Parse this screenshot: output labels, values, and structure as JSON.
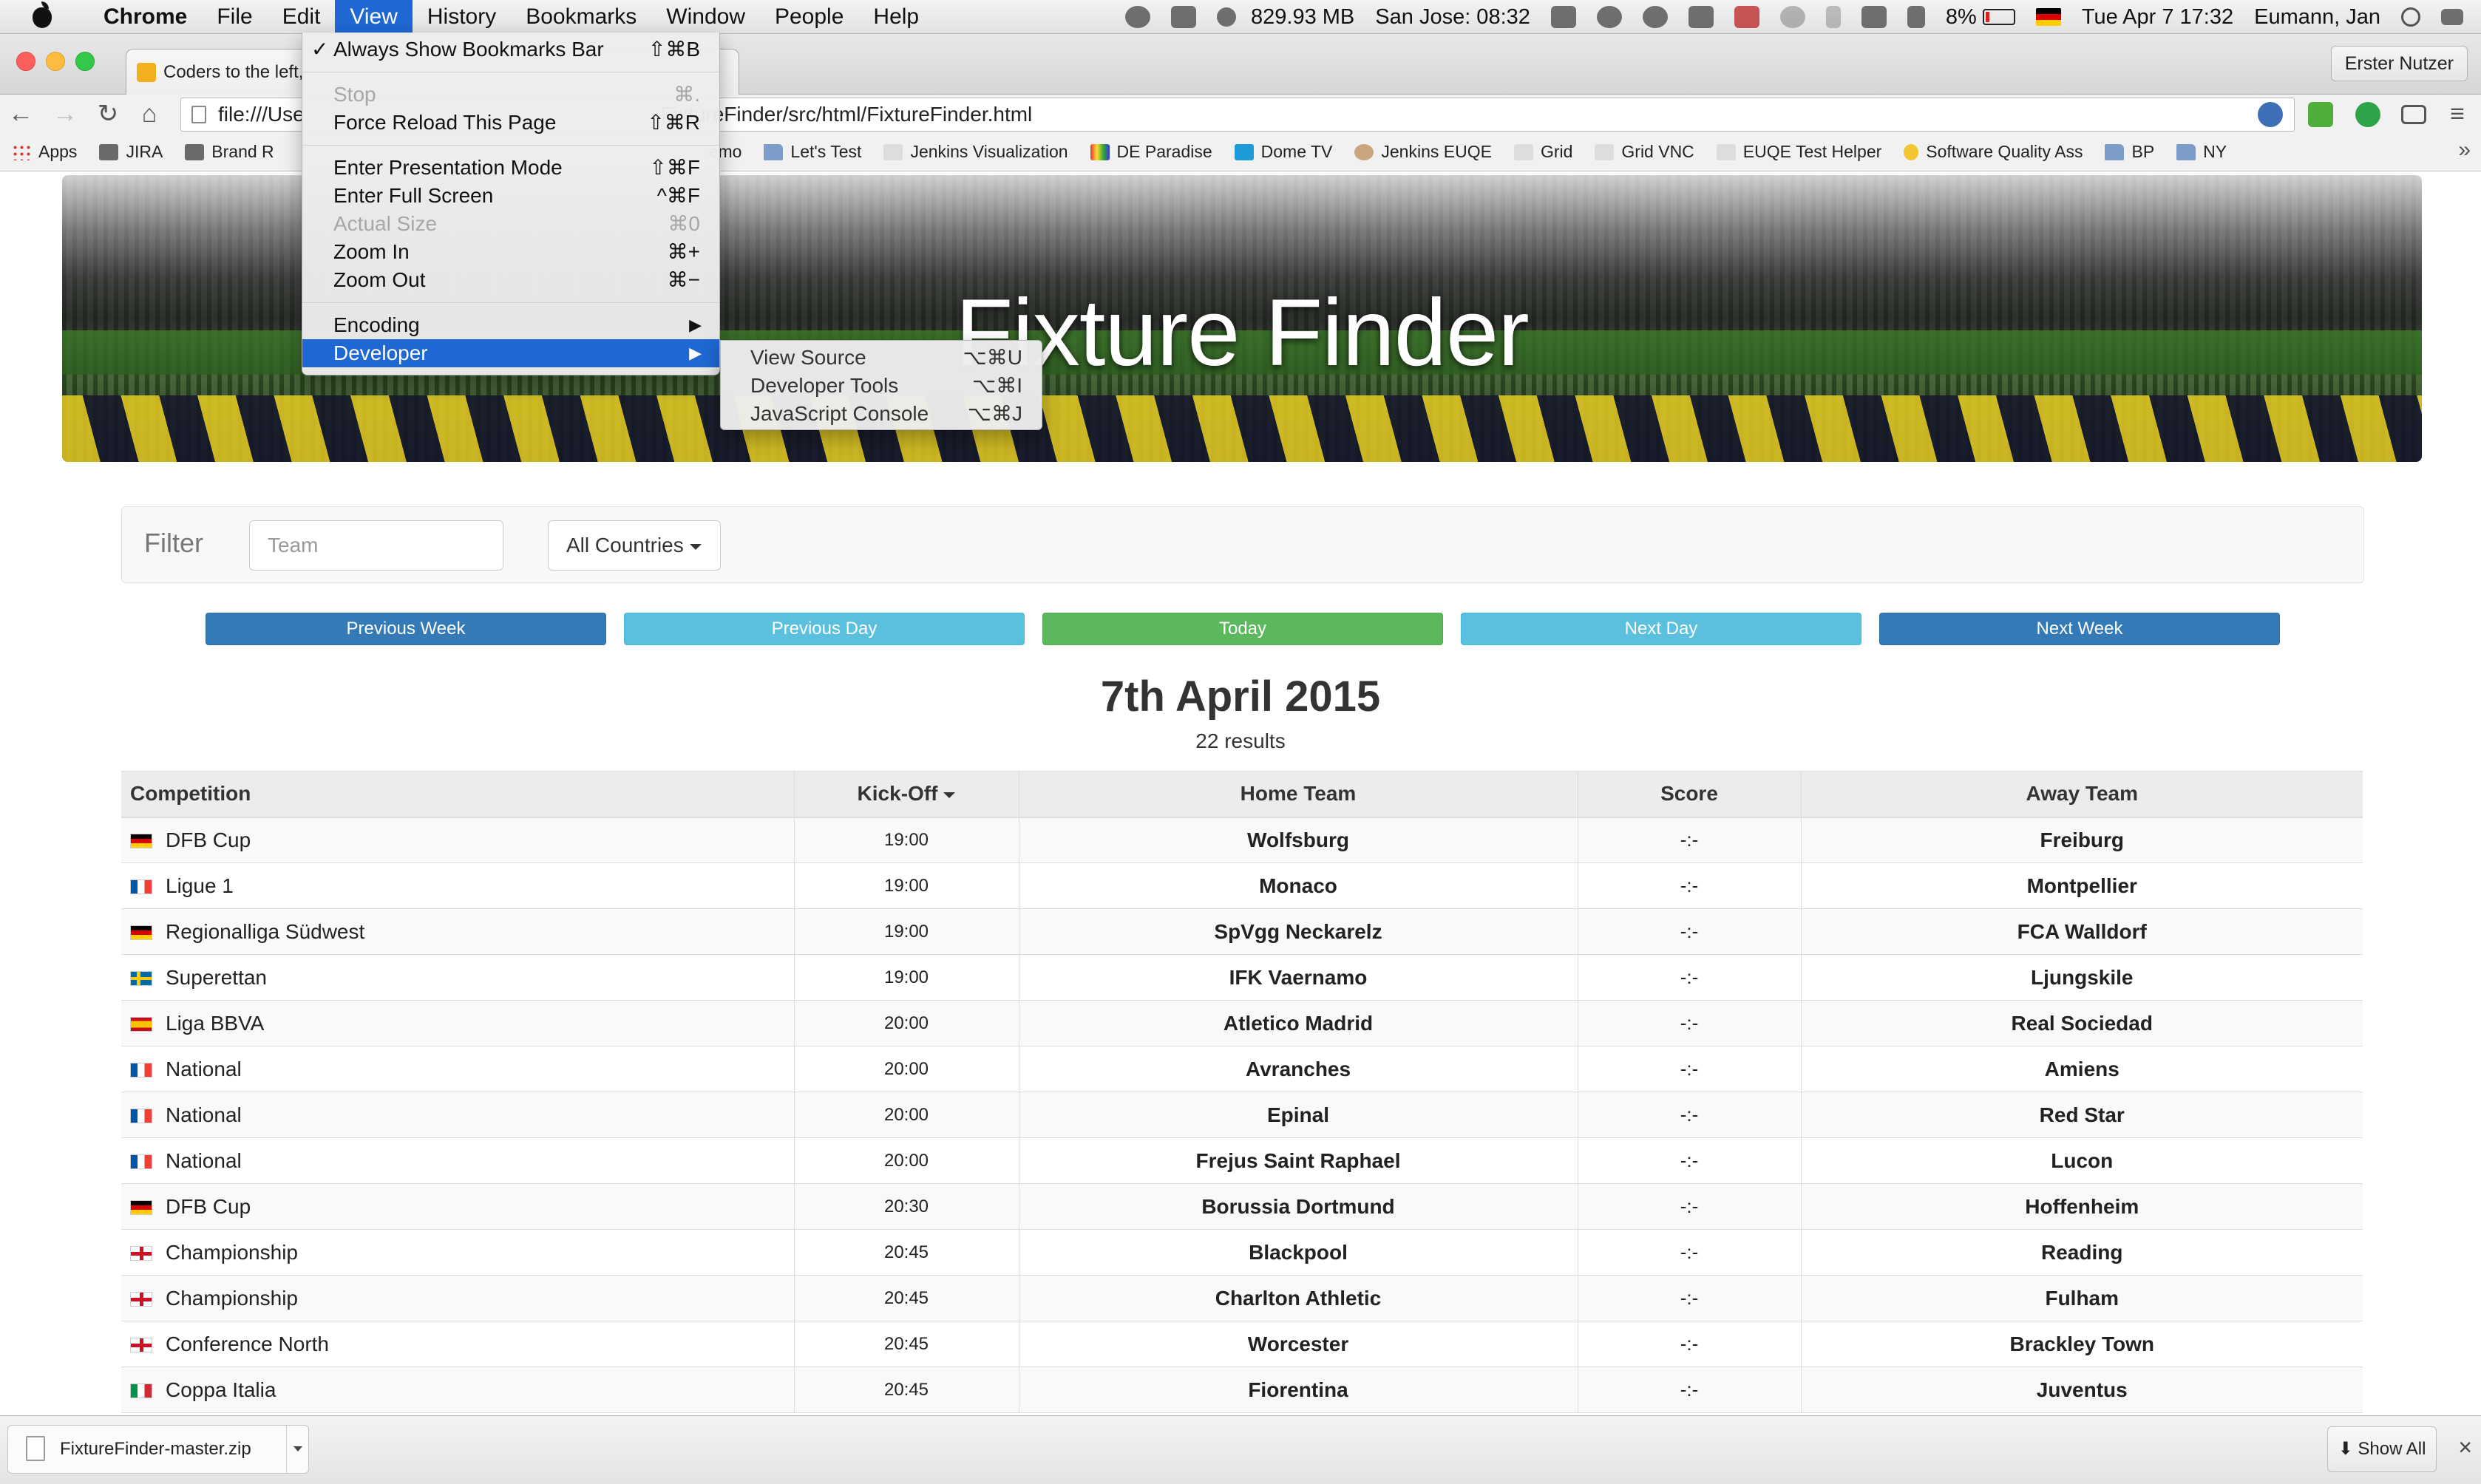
{
  "menubar": {
    "app": "Chrome",
    "items": [
      "File",
      "Edit",
      "View",
      "History",
      "Bookmarks",
      "Window",
      "People",
      "Help"
    ],
    "active_item": "View",
    "status": {
      "memory": "829.93 MB",
      "clock_city": "San Jose: 08:32",
      "battery": "8%",
      "datetime": "Tue Apr 7  17:32",
      "user": "Eumann, Jan"
    }
  },
  "window": {
    "tab_title": "Coders to the left,",
    "profile": "Erster Nutzer"
  },
  "address_bar": {
    "url_left": "file:///Use",
    "url_right": "FixtureFinder/src/html/FixtureFinder.html"
  },
  "bookmarks": {
    "left": [
      "Apps",
      "JIRA",
      "Brand R"
    ],
    "right": [
      {
        "label": "emo",
        "icon": "none"
      },
      {
        "label": "Let's Test",
        "icon": "folder"
      },
      {
        "label": "Jenkins Visualization",
        "icon": "page"
      },
      {
        "label": "DE Paradise",
        "icon": "page"
      },
      {
        "label": "Dome TV",
        "icon": "page"
      },
      {
        "label": "Jenkins EUQE",
        "icon": "page"
      },
      {
        "label": "Grid",
        "icon": "page"
      },
      {
        "label": "Grid VNC",
        "icon": "page"
      },
      {
        "label": "EUQE Test Helper",
        "icon": "page"
      },
      {
        "label": "Software Quality Ass",
        "icon": "page"
      },
      {
        "label": "BP",
        "icon": "folder"
      },
      {
        "label": "NY",
        "icon": "folder"
      }
    ],
    "overflow": "»"
  },
  "view_menu": {
    "always_show_bookmarks": {
      "label": "Always Show Bookmarks Bar",
      "shortcut": "⇧⌘B",
      "check": "✓"
    },
    "stop": {
      "label": "Stop",
      "shortcut": "⌘."
    },
    "force_reload": {
      "label": "Force Reload This Page",
      "shortcut": "⇧⌘R"
    },
    "presentation": {
      "label": "Enter Presentation Mode",
      "shortcut": "⇧⌘F"
    },
    "fullscreen": {
      "label": "Enter Full Screen",
      "shortcut": "^⌘F"
    },
    "actual_size": {
      "label": "Actual Size",
      "shortcut": "⌘0"
    },
    "zoom_in": {
      "label": "Zoom In",
      "shortcut": "⌘+"
    },
    "zoom_out": {
      "label": "Zoom Out",
      "shortcut": "⌘−"
    },
    "encoding": {
      "label": "Encoding"
    },
    "developer": {
      "label": "Developer"
    }
  },
  "developer_submenu": {
    "view_source": {
      "label": "View Source",
      "shortcut": "⌥⌘U"
    },
    "dev_tools": {
      "label": "Developer Tools",
      "shortcut": "⌥⌘I"
    },
    "js_console": {
      "label": "JavaScript Console",
      "shortcut": "⌥⌘J"
    }
  },
  "page": {
    "title": "Fixture Finder",
    "filter": {
      "label": "Filter",
      "team_placeholder": "Team",
      "country_selected": "All Countries"
    },
    "nav": {
      "prev_week": "Previous Week",
      "prev_day": "Previous Day",
      "today": "Today",
      "next_day": "Next Day",
      "next_week": "Next Week"
    },
    "date": "7th April 2015",
    "results": "22 results",
    "colors": {
      "primary": "#337ab7",
      "info": "#5bc0de",
      "success": "#5cb85c"
    }
  },
  "table": {
    "headers": {
      "competition": "Competition",
      "kickoff": "Kick-Off",
      "home": "Home Team",
      "score": "Score",
      "away": "Away Team"
    },
    "rows": [
      {
        "flag": "de",
        "competition": "DFB Cup",
        "kickoff": "19:00",
        "home": "Wolfsburg",
        "score": "-:-",
        "away": "Freiburg"
      },
      {
        "flag": "fr",
        "competition": "Ligue 1",
        "kickoff": "19:00",
        "home": "Monaco",
        "score": "-:-",
        "away": "Montpellier"
      },
      {
        "flag": "de",
        "competition": "Regionalliga Südwest",
        "kickoff": "19:00",
        "home": "SpVgg Neckarelz",
        "score": "-:-",
        "away": "FCA Walldorf"
      },
      {
        "flag": "se",
        "competition": "Superettan",
        "kickoff": "19:00",
        "home": "IFK Vaernamo",
        "score": "-:-",
        "away": "Ljungskile"
      },
      {
        "flag": "es",
        "competition": "Liga BBVA",
        "kickoff": "20:00",
        "home": "Atletico Madrid",
        "score": "-:-",
        "away": "Real Sociedad"
      },
      {
        "flag": "fr",
        "competition": "National",
        "kickoff": "20:00",
        "home": "Avranches",
        "score": "-:-",
        "away": "Amiens"
      },
      {
        "flag": "fr",
        "competition": "National",
        "kickoff": "20:00",
        "home": "Epinal",
        "score": "-:-",
        "away": "Red Star"
      },
      {
        "flag": "fr",
        "competition": "National",
        "kickoff": "20:00",
        "home": "Frejus Saint Raphael",
        "score": "-:-",
        "away": "Lucon"
      },
      {
        "flag": "de",
        "competition": "DFB Cup",
        "kickoff": "20:30",
        "home": "Borussia Dortmund",
        "score": "-:-",
        "away": "Hoffenheim"
      },
      {
        "flag": "en",
        "competition": "Championship",
        "kickoff": "20:45",
        "home": "Blackpool",
        "score": "-:-",
        "away": "Reading"
      },
      {
        "flag": "en",
        "competition": "Championship",
        "kickoff": "20:45",
        "home": "Charlton Athletic",
        "score": "-:-",
        "away": "Fulham"
      },
      {
        "flag": "en",
        "competition": "Conference North",
        "kickoff": "20:45",
        "home": "Worcester",
        "score": "-:-",
        "away": "Brackley Town"
      },
      {
        "flag": "it",
        "competition": "Coppa Italia",
        "kickoff": "20:45",
        "home": "Fiorentina",
        "score": "-:-",
        "away": "Juventus"
      }
    ]
  },
  "download_shelf": {
    "file": "FixtureFinder-master.zip",
    "show_all": "Show All",
    "close": "×"
  }
}
